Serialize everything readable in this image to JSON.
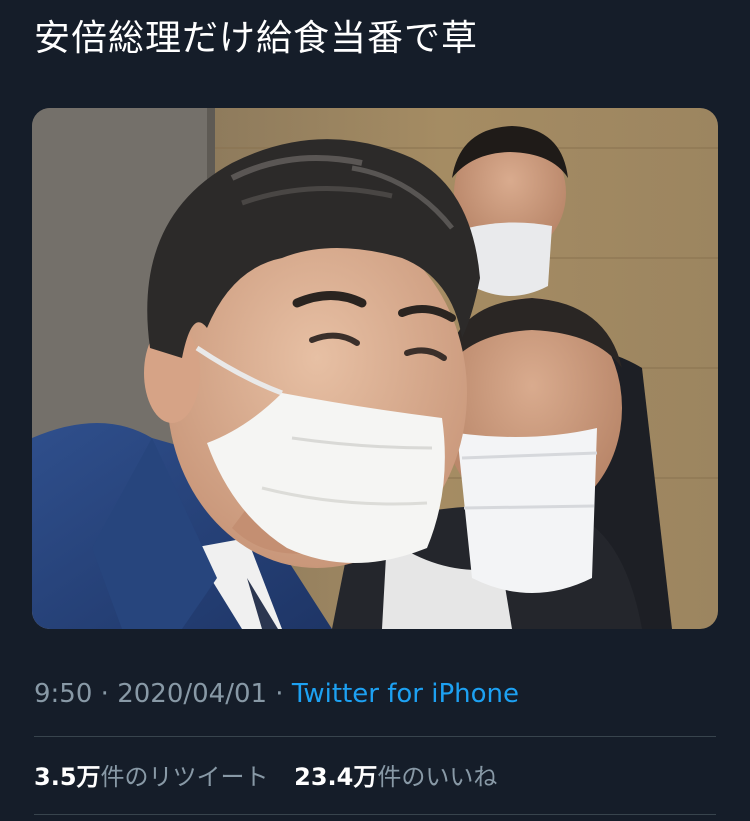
{
  "tweet": {
    "text": "安倍総理だけ給食当番で草",
    "media_alt": "",
    "time": "9:50",
    "separator": " · ",
    "date": "2020/04/01",
    "source": "Twitter for iPhone"
  },
  "stats": {
    "retweets": {
      "count": "3.5万",
      "label": "件のリツイート"
    },
    "likes": {
      "count": "23.4万",
      "label": "件のいいね"
    }
  },
  "colors": {
    "background": "#151d29",
    "text": "#ffffff",
    "muted": "#8899a6",
    "link": "#1da1f2",
    "divider": "#38444d"
  }
}
